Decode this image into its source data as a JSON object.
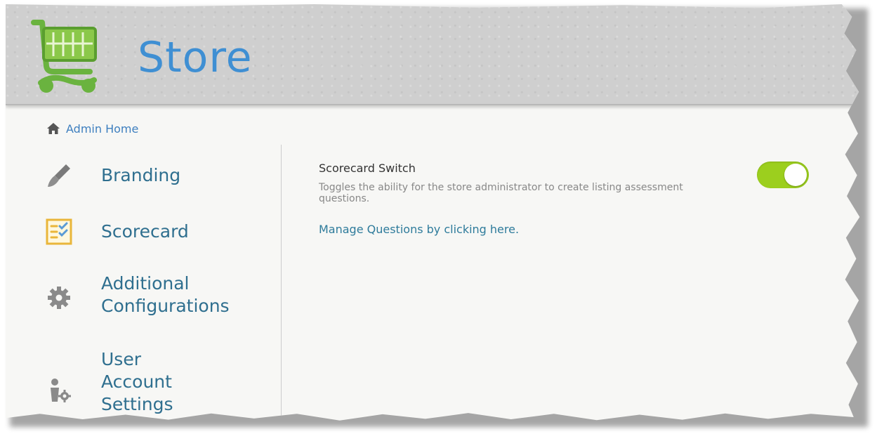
{
  "header": {
    "title": "Store",
    "logo_icon": "shopping-cart-icon",
    "logo_color": "#6ab33f"
  },
  "breadcrumb": {
    "icon": "home-icon",
    "label": "Admin Home"
  },
  "sidebar": {
    "items": [
      {
        "label": "Branding",
        "icon": "paintbrush-icon"
      },
      {
        "label": "Scorecard",
        "icon": "checklist-icon"
      },
      {
        "label": "Additional Configurations",
        "icon": "gear-icon"
      },
      {
        "label": "User Account Settings",
        "icon": "user-settings-icon"
      }
    ]
  },
  "settings": {
    "scorecard_switch": {
      "title": "Scorecard Switch",
      "description": "Toggles the ability for the store administrator to create listing assessment questions.",
      "enabled": true,
      "toggle_color": "#9ccf1e"
    },
    "manage_link": "Manage Questions by clicking here."
  },
  "colors": {
    "title_blue": "#3f8fd3",
    "nav_text": "#2f6f8f",
    "link_text": "#2e7b9b"
  }
}
